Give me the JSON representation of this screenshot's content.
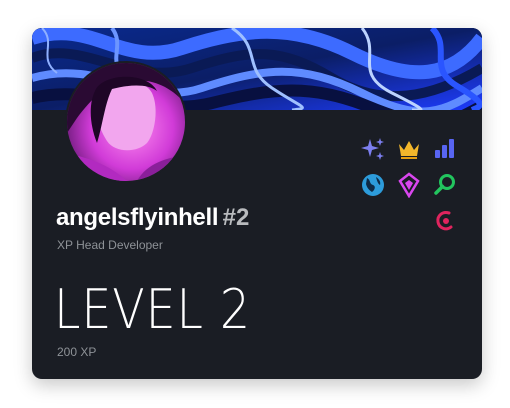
{
  "profile": {
    "username": "angelsflyinhell",
    "discriminator": "#2",
    "role": "XP Head Developer",
    "level": "LEVEL 2",
    "xp": "200 XP"
  },
  "badges": [
    {
      "name": "sparkles-icon",
      "color": "#7c7ff0"
    },
    {
      "name": "crown-icon",
      "color": "#f3b72b"
    },
    {
      "name": "signal-bars-icon",
      "color": "#5865f2"
    },
    {
      "name": "globe-icon",
      "color": "#2d9cdb"
    },
    {
      "name": "gem-icon",
      "color": "#d946ef"
    },
    {
      "name": "magnifier-icon",
      "color": "#22c55e"
    },
    {
      "name": "swirl-icon",
      "color": "#e0245e"
    }
  ],
  "colors": {
    "card_bg": "#1a1d24",
    "banner_primary": "#1e40ff",
    "banner_dark": "#06123d",
    "avatar_tint": "#e040e0"
  }
}
